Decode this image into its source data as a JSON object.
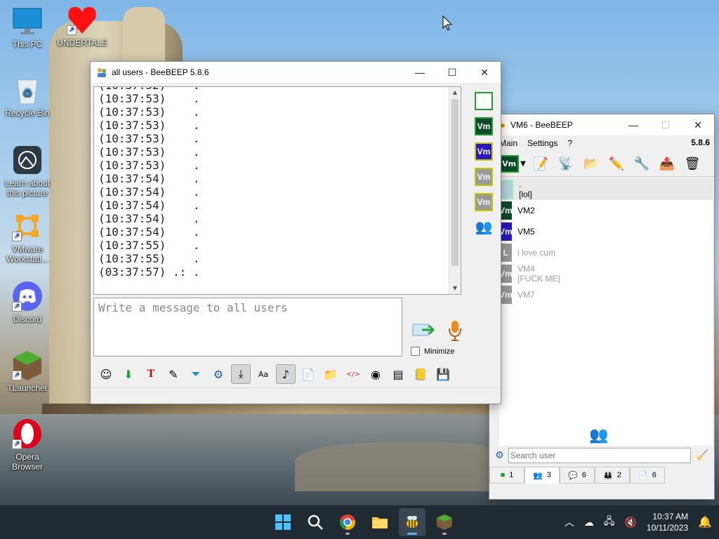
{
  "desktop": {
    "icons": [
      {
        "label": "This PC",
        "icon": "monitor-icon"
      },
      {
        "label": "UNDERTALE",
        "icon": "heart-icon"
      },
      {
        "label": "Recycle Bin",
        "icon": "recycle-bin-icon"
      },
      {
        "label": "Learn about this picture",
        "icon": "camera-icon"
      },
      {
        "label": "VMware Workstati...",
        "icon": "vmware-icon"
      },
      {
        "label": "Discord",
        "icon": "discord-icon"
      },
      {
        "label": "TLauncher",
        "icon": "minecraft-block-icon"
      },
      {
        "label": "Opera Browser",
        "icon": "opera-icon"
      }
    ]
  },
  "chat_window": {
    "title": "all users - BeeBEEP 5.8.6",
    "log": [
      "(10:37:53)    .",
      "(10:37:53)    .",
      "(10:37:53)    .",
      "(10:37:53)    .",
      "(10:37:53)    .",
      "(10:37:53)    .",
      "(10:37:54)    .",
      "(10:37:54)    .",
      "(10:37:54)    .",
      "(10:37:54)    .",
      "(10:37:54)    .",
      "(10:37:55)    .",
      "(10:37:55)    .",
      "(03:37:57) .: ."
    ],
    "partial_top_line": "(10:37:52)    .",
    "message_placeholder": "Write a message to all users",
    "minimize_label": "Minimize",
    "sidebar_users": [
      {
        "label": "",
        "color": "#ffffff",
        "border": "#1fa02c"
      },
      {
        "label": "Vm",
        "color": "#0e4a2a",
        "border": "#1fa02c"
      },
      {
        "label": "Vm",
        "color": "#2a18c4",
        "border": "#c9c600"
      },
      {
        "label": "Vm",
        "color": "#9a9a9a",
        "border": "#c9c600"
      },
      {
        "label": "Vm",
        "color": "#9a9a9a",
        "border": "#c9c600"
      }
    ]
  },
  "vm_window": {
    "title": "VM6 - BeeBEEP",
    "menu": [
      "Main",
      "Settings",
      "?"
    ],
    "version": "5.8.6",
    "status_button": "Vm",
    "users": [
      {
        "name": ".",
        "status": "[lol]",
        "avatar": "",
        "color": "#b5d5da",
        "online": true,
        "selected": true
      },
      {
        "name": "VM2",
        "status": "",
        "avatar": "Vm",
        "color": "#0e4a2a",
        "online": true,
        "selected": false
      },
      {
        "name": "VM5",
        "status": "",
        "avatar": "Vm",
        "color": "#2a18c4",
        "online": true,
        "selected": false
      },
      {
        "name": "i love cum",
        "status": "",
        "avatar": "L",
        "color": "#9a9a9a",
        "online": false,
        "selected": false
      },
      {
        "name": "VM4",
        "status": "[FUCK ME]",
        "avatar": "Vm",
        "color": "#9a9a9a",
        "online": false,
        "selected": false
      },
      {
        "name": "VM7",
        "status": "",
        "avatar": "Vm",
        "color": "#9a9a9a",
        "online": false,
        "selected": false
      }
    ],
    "search_placeholder": "Search user",
    "tabs": [
      {
        "count": "1",
        "icon": "chat-icon"
      },
      {
        "count": "3",
        "icon": "users-icon"
      },
      {
        "count": "6",
        "icon": "group-chat-icon"
      },
      {
        "count": "2",
        "icon": "groups-icon"
      },
      {
        "count": "6",
        "icon": "files-icon"
      }
    ]
  },
  "taskbar": {
    "time": "10:37 AM",
    "date": "10/11/2023"
  }
}
